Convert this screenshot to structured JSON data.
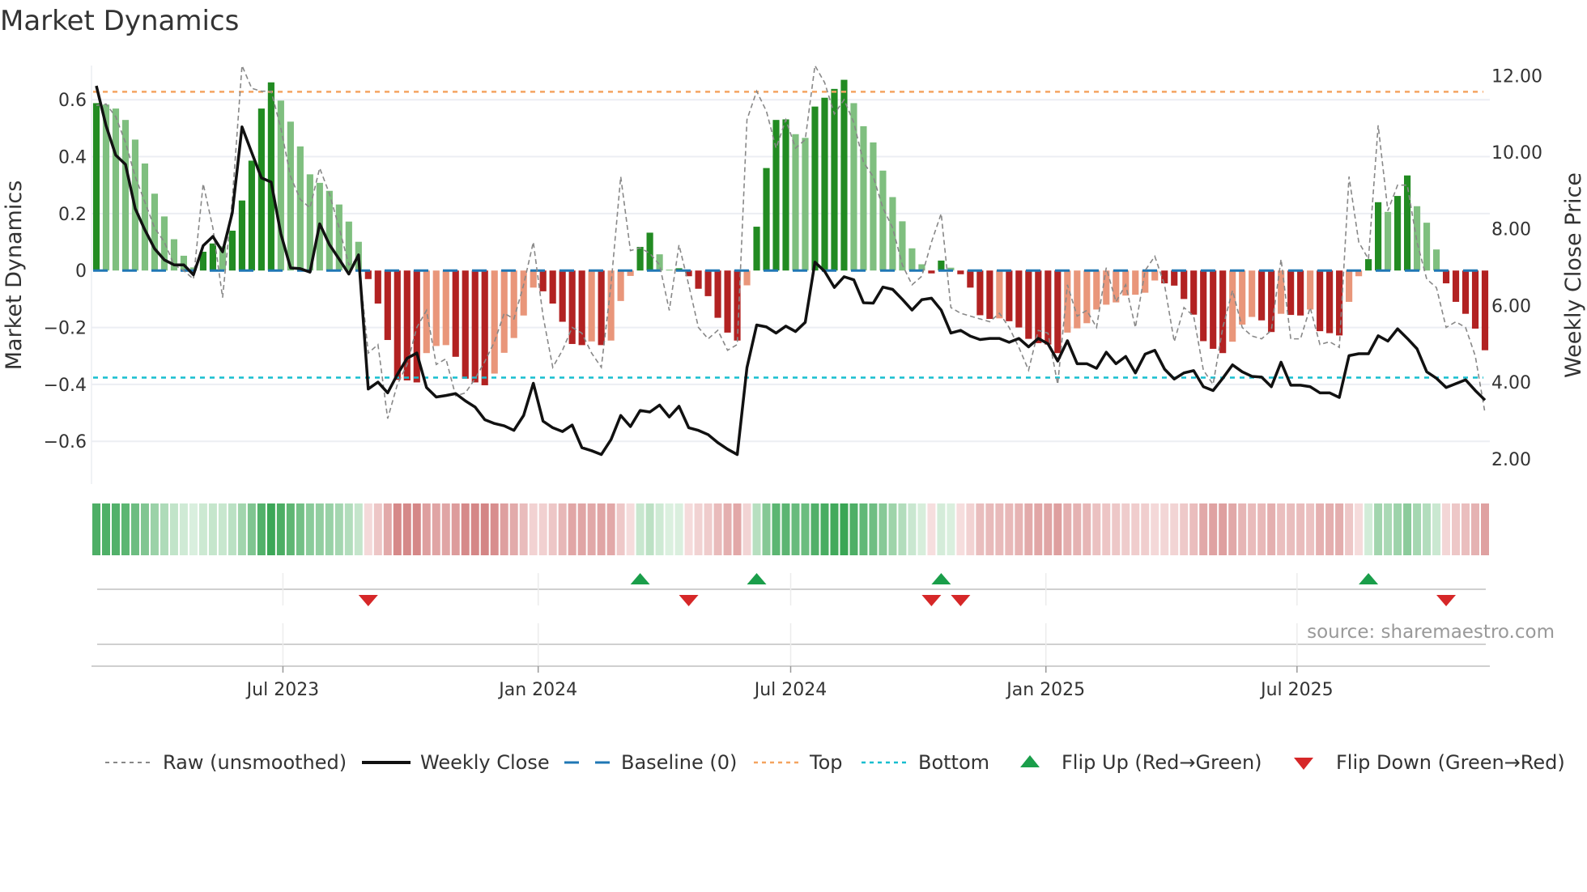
{
  "title": "Market Dynamics",
  "source": "source: sharemaestro.com",
  "chart_data": {
    "type": "bar",
    "title": "Market Dynamics",
    "ylabel": "Market Dynamics",
    "y2label": "Weekly Close Price",
    "start_date": "2023-02-13",
    "frequency": "weekly",
    "ylim": [
      -0.75,
      0.72
    ],
    "y2lim": [
      1.34,
      12.26
    ],
    "yticks": [
      0.6,
      0.4,
      0.2,
      0,
      -0.2,
      -0.4,
      -0.6
    ],
    "ytick_labels": [
      "0.6",
      "0.4",
      "0.2",
      "0",
      "−0.2",
      "−0.4",
      "−0.6"
    ],
    "y2ticks": [
      12,
      10,
      8,
      6,
      4,
      2
    ],
    "y2tick_labels": [
      "12.00",
      "10.00",
      "8.00",
      "6.00",
      "4.00",
      "2.00"
    ],
    "xticks": [
      {
        "date": "2023-07-01",
        "label": "Jul 2023"
      },
      {
        "date": "2024-01-01",
        "label": "Jan 2024"
      },
      {
        "date": "2024-07-01",
        "label": "Jul 2024"
      },
      {
        "date": "2025-01-01",
        "label": "Jan 2025"
      },
      {
        "date": "2025-07-01",
        "label": "Jul 2025"
      }
    ],
    "levels": {
      "baseline": 0,
      "top": 0.628,
      "bottom": -0.376
    },
    "grid": true,
    "legend_position": "bottom",
    "colors": {
      "green_strong": "#228b22",
      "green_weak": "#7fbf7f",
      "red_strong": "#b22222",
      "red_weak": "#e9967a",
      "close": "#111111",
      "raw": "#888888",
      "baseline": "#1f77b4",
      "top": "#f4a460",
      "bottom": "#17becf",
      "flip_up": "#1a9e4a",
      "flip_down": "#d62728"
    },
    "series": [
      {
        "name": "Market Dynamics (smoothed)",
        "axis": "left",
        "values": [
          0.588,
          0.583,
          0.569,
          0.529,
          0.46,
          0.376,
          0.27,
          0.19,
          0.11,
          0.052,
          0.011,
          0.066,
          0.095,
          0.085,
          0.14,
          0.246,
          0.386,
          0.569,
          0.661,
          0.597,
          0.523,
          0.436,
          0.338,
          0.308,
          0.28,
          0.232,
          0.172,
          0.101,
          -0.03,
          -0.116,
          -0.244,
          -0.384,
          -0.386,
          -0.393,
          -0.29,
          -0.265,
          -0.262,
          -0.303,
          -0.38,
          -0.393,
          -0.403,
          -0.362,
          -0.289,
          -0.237,
          -0.158,
          -0.06,
          -0.073,
          -0.116,
          -0.18,
          -0.258,
          -0.262,
          -0.249,
          -0.262,
          -0.246,
          -0.107,
          -0.019,
          0.083,
          0.133,
          0.057,
          0.003,
          0.008,
          -0.02,
          -0.064,
          -0.09,
          -0.166,
          -0.218,
          -0.246,
          -0.052,
          0.154,
          0.36,
          0.529,
          0.531,
          0.479,
          0.466,
          0.576,
          0.607,
          0.638,
          0.67,
          0.588,
          0.507,
          0.45,
          0.351,
          0.258,
          0.173,
          0.078,
          0.022,
          -0.01,
          0.035,
          0.01,
          -0.013,
          -0.06,
          -0.157,
          -0.17,
          -0.168,
          -0.178,
          -0.2,
          -0.24,
          -0.255,
          -0.26,
          -0.29,
          -0.218,
          -0.203,
          -0.185,
          -0.137,
          -0.12,
          -0.112,
          -0.088,
          -0.085,
          -0.078,
          -0.035,
          -0.045,
          -0.053,
          -0.1,
          -0.155,
          -0.248,
          -0.275,
          -0.29,
          -0.25,
          -0.19,
          -0.163,
          -0.175,
          -0.216,
          -0.152,
          -0.156,
          -0.158,
          -0.137,
          -0.213,
          -0.22,
          -0.228,
          -0.11,
          -0.02,
          0.04,
          0.24,
          0.206,
          0.262,
          0.334,
          0.226,
          0.168,
          0.074,
          -0.045,
          -0.11,
          -0.152,
          -0.204,
          -0.28
        ]
      },
      {
        "name": "Raw (unsmoothed)",
        "axis": "left",
        "values": [
          0.58,
          0.585,
          0.54,
          0.45,
          0.33,
          0.24,
          0.15,
          0.1,
          0.02,
          0.0,
          -0.03,
          0.305,
          0.15,
          -0.095,
          0.25,
          0.72,
          0.64,
          0.63,
          0.63,
          0.5,
          0.33,
          0.25,
          0.22,
          0.36,
          0.27,
          0.15,
          0.02,
          0.04,
          -0.29,
          -0.26,
          -0.52,
          -0.4,
          -0.33,
          -0.2,
          -0.14,
          -0.33,
          -0.31,
          -0.44,
          -0.43,
          -0.38,
          -0.32,
          -0.25,
          -0.15,
          -0.17,
          -0.05,
          0.1,
          -0.16,
          -0.34,
          -0.28,
          -0.2,
          -0.22,
          -0.29,
          -0.34,
          -0.05,
          0.33,
          0.07,
          0.08,
          0.06,
          0.02,
          -0.14,
          0.09,
          -0.05,
          -0.2,
          -0.24,
          -0.21,
          -0.28,
          -0.26,
          0.53,
          0.63,
          0.56,
          0.43,
          0.53,
          0.43,
          0.46,
          0.72,
          0.66,
          0.55,
          0.6,
          0.52,
          0.38,
          0.33,
          0.22,
          0.15,
          0.02,
          -0.05,
          -0.02,
          0.1,
          0.2,
          -0.13,
          -0.15,
          -0.16,
          -0.17,
          -0.18,
          -0.15,
          -0.2,
          -0.27,
          -0.35,
          -0.21,
          -0.22,
          -0.4,
          -0.05,
          -0.16,
          -0.14,
          -0.2,
          0.01,
          -0.11,
          -0.05,
          -0.2,
          0.0,
          0.05,
          -0.05,
          -0.25,
          -0.13,
          -0.16,
          -0.35,
          -0.4,
          -0.2,
          -0.07,
          -0.2,
          -0.23,
          -0.24,
          -0.21,
          0.04,
          -0.24,
          -0.24,
          -0.13,
          -0.26,
          -0.25,
          -0.27,
          0.33,
          0.1,
          0.04,
          0.51,
          0.21,
          0.3,
          0.3,
          0.1,
          -0.03,
          -0.06,
          -0.2,
          -0.18,
          -0.2,
          -0.3,
          -0.5
        ]
      },
      {
        "name": "Weekly Close",
        "axis": "right",
        "values": [
          11.73,
          10.69,
          9.92,
          9.68,
          8.53,
          7.97,
          7.48,
          7.19,
          7.06,
          7.06,
          6.8,
          7.56,
          7.8,
          7.4,
          8.42,
          10.66,
          9.99,
          9.33,
          9.22,
          7.87,
          6.98,
          6.96,
          6.87,
          8.13,
          7.59,
          7.21,
          6.82,
          7.32,
          3.82,
          4.0,
          3.72,
          4.2,
          4.62,
          4.76,
          3.86,
          3.61,
          3.65,
          3.7,
          3.51,
          3.35,
          3.02,
          2.92,
          2.86,
          2.74,
          3.13,
          3.97,
          2.98,
          2.81,
          2.71,
          2.88,
          2.29,
          2.21,
          2.11,
          2.5,
          3.13,
          2.84,
          3.26,
          3.22,
          3.4,
          3.09,
          3.37,
          2.81,
          2.74,
          2.63,
          2.42,
          2.25,
          2.11,
          4.38,
          5.49,
          5.44,
          5.28,
          5.46,
          5.32,
          5.56,
          7.13,
          6.89,
          6.47,
          6.75,
          6.67,
          6.07,
          6.06,
          6.48,
          6.42,
          6.16,
          5.88,
          6.15,
          6.19,
          5.88,
          5.28,
          5.35,
          5.2,
          5.11,
          5.14,
          5.14,
          5.04,
          5.14,
          4.92,
          5.14,
          5.0,
          4.55,
          5.08,
          4.48,
          4.48,
          4.36,
          4.78,
          4.48,
          4.67,
          4.24,
          4.73,
          4.83,
          4.34,
          4.08,
          4.24,
          4.3,
          3.88,
          3.78,
          4.1,
          4.45,
          4.27,
          4.15,
          4.13,
          3.88,
          4.52,
          3.92,
          3.92,
          3.88,
          3.72,
          3.72,
          3.6,
          4.69,
          4.74,
          4.74,
          5.21,
          5.07,
          5.39,
          5.14,
          4.87,
          4.27,
          4.1,
          3.86,
          3.96,
          4.06,
          3.78,
          3.53
        ]
      }
    ],
    "legend": [
      {
        "key": "raw",
        "label": "Raw (unsmoothed)"
      },
      {
        "key": "close",
        "label": "Weekly Close"
      },
      {
        "key": "baseline",
        "label": "Baseline (0)"
      },
      {
        "key": "top",
        "label": "Top"
      },
      {
        "key": "bottom",
        "label": "Bottom"
      },
      {
        "key": "flip_up",
        "label": "Flip Up (Red→Green)"
      },
      {
        "key": "flip_down",
        "label": "Flip Down (Green→Red)"
      }
    ]
  }
}
